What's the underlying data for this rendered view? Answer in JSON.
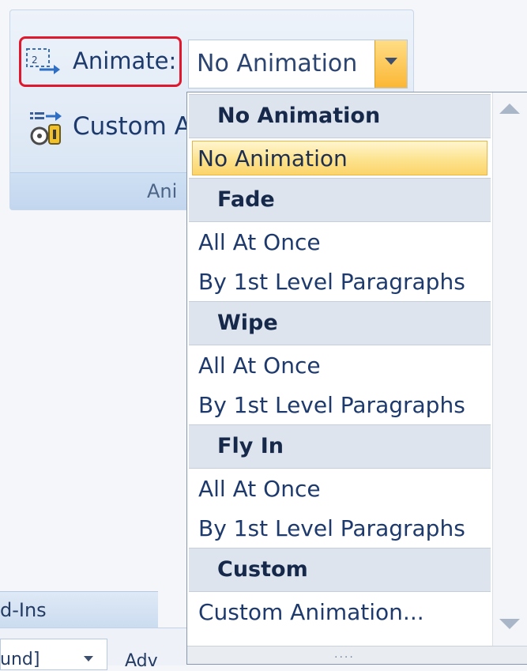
{
  "ribbon": {
    "animate_label": "Animate:",
    "custom_label": "Custom A",
    "group_label": "Ani",
    "animate_icon": "animate-icon",
    "custom_icon": "custom-animation-icon"
  },
  "combo": {
    "value": "No Animation",
    "arrow_icon": "chevron-down-icon"
  },
  "dropdown": {
    "sections": [
      {
        "header": "No Animation",
        "items": [
          "No Animation"
        ],
        "selected_index": 0
      },
      {
        "header": "Fade",
        "items": [
          "All At Once",
          "By 1st Level Paragraphs"
        ]
      },
      {
        "header": "Wipe",
        "items": [
          "All At Once",
          "By 1st Level Paragraphs"
        ]
      },
      {
        "header": "Fly In",
        "items": [
          "All At Once",
          "By 1st Level Paragraphs"
        ]
      },
      {
        "header": "Custom",
        "items": [
          "Custom Animation..."
        ]
      }
    ],
    "grip": "····"
  },
  "background": {
    "tab_label": "d-Ins",
    "combo_text": "und]",
    "next_text": "Adv"
  },
  "colors": {
    "highlight_border": "#e0182d",
    "selected_item": "#fde38e",
    "combo_arrow": "#fbb735"
  }
}
